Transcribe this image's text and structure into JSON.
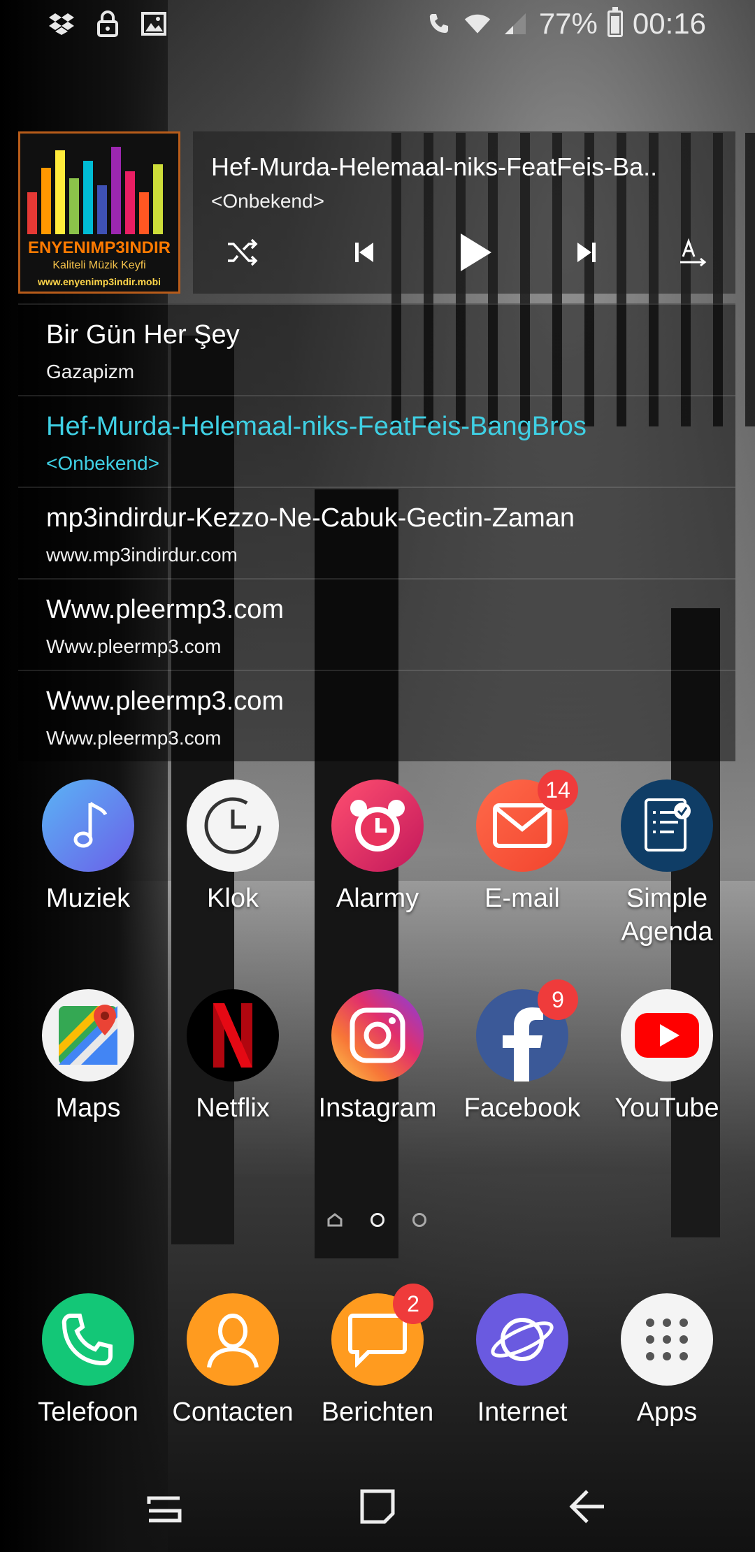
{
  "status_bar": {
    "battery": "77%",
    "time": "00:16",
    "battery_level": 0.77,
    "left_icons": [
      "dropbox-icon",
      "lock-icon",
      "image-icon"
    ],
    "right_icons": [
      "wifi-call-icon",
      "wifi-icon",
      "signal-icon",
      "battery-icon"
    ]
  },
  "music_widget": {
    "album_art": {
      "brand": "ENYENIMP3INDIR",
      "tagline": "Kaliteli Müzik Keyfi",
      "url": "www.enyenimp3indir.mobi"
    },
    "now_playing": {
      "title": "Hef-Murda-Helemaal-niks-FeatFeis-Ba..",
      "artist": "<Onbekend>"
    },
    "controls": [
      "shuffle-icon",
      "previous-icon",
      "play-icon",
      "next-icon",
      "text-size-icon"
    ],
    "accent_color": "#3fd0e4",
    "playlist": [
      {
        "title": "Bir Gün Her Şey",
        "artist": "Gazapizm",
        "active": false
      },
      {
        "title": "Hef-Murda-Helemaal-niks-FeatFeis-BangBros",
        "artist": "<Onbekend>",
        "active": true
      },
      {
        "title": "mp3indirdur-Kezzo-Ne-Cabuk-Gectin-Zaman",
        "artist": "www.mp3indirdur.com",
        "active": false
      },
      {
        "title": "Www.pleermp3.com",
        "artist": "Www.pleermp3.com",
        "active": false
      },
      {
        "title": "Www.pleermp3.com",
        "artist": "Www.pleermp3.com",
        "active": false
      }
    ]
  },
  "home_apps": {
    "row1": [
      {
        "label": "Muziek",
        "icon": "music-note-icon"
      },
      {
        "label": "Klok",
        "icon": "clock-icon"
      },
      {
        "label": "Alarmy",
        "icon": "alarm-clock-icon"
      },
      {
        "label": "E-mail",
        "icon": "envelope-icon",
        "badge": "14"
      },
      {
        "label": "Simple\nAgenda",
        "label_line1": "Simple",
        "label_line2": "Agenda",
        "icon": "agenda-icon"
      }
    ],
    "row2": [
      {
        "label": "Maps",
        "icon": "maps-icon"
      },
      {
        "label": "Netflix",
        "icon": "netflix-icon"
      },
      {
        "label": "Instagram",
        "icon": "instagram-icon"
      },
      {
        "label": "Facebook",
        "icon": "facebook-icon",
        "badge": "9"
      },
      {
        "label": "YouTube",
        "icon": "youtube-icon"
      }
    ]
  },
  "page_indicator": {
    "pages": 3,
    "current": 1
  },
  "dock": [
    {
      "label": "Telefoon",
      "icon": "phone-icon"
    },
    {
      "label": "Contacten",
      "icon": "contacts-icon"
    },
    {
      "label": "Berichten",
      "icon": "messages-icon",
      "badge": "2"
    },
    {
      "label": "Internet",
      "icon": "internet-icon"
    },
    {
      "label": "Apps",
      "icon": "apps-grid-icon"
    }
  ],
  "nav_bar": [
    "recents-icon",
    "home-icon",
    "back-icon"
  ]
}
